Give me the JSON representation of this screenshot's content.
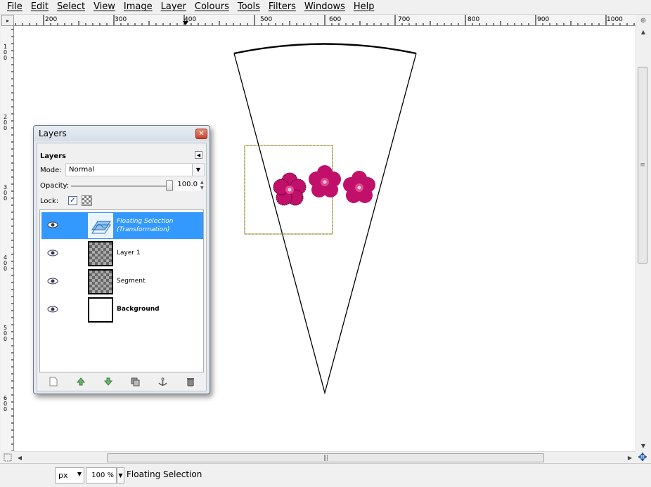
{
  "menubar": {
    "items": [
      "File",
      "Edit",
      "Select",
      "View",
      "Image",
      "Layer",
      "Colours",
      "Tools",
      "Filters",
      "Windows",
      "Help"
    ]
  },
  "ruler": {
    "h_labels": [
      "200",
      "300",
      "400",
      "500",
      "600",
      "700",
      "800",
      "900",
      "1000"
    ],
    "v_labels": [
      "100",
      "200",
      "300",
      "400",
      "500",
      "600"
    ]
  },
  "layers_dialog": {
    "title": "Layers",
    "panel_title": "Layers",
    "mode_label": "Mode:",
    "mode_value": "Normal",
    "opacity_label": "Opacity:",
    "opacity_value": "100.0",
    "lock_label": "Lock:",
    "lock_pixels_checked": true,
    "layers": [
      {
        "name_line1": "Floating Selection",
        "name_line2": "(Transformation)",
        "selected": true,
        "visible": true
      },
      {
        "name_line1": "Layer 1",
        "selected": false,
        "visible": true
      },
      {
        "name_line1": "Segment",
        "selected": false,
        "visible": true
      },
      {
        "name_line1": "Background",
        "selected": false,
        "visible": true
      }
    ],
    "buttons": [
      "new-layer",
      "raise-layer",
      "lower-layer",
      "duplicate-layer",
      "anchor-layer",
      "delete-layer"
    ]
  },
  "statusbar": {
    "unit": "px",
    "zoom": "100 %",
    "message": "Floating Selection"
  },
  "colors": {
    "selection_highlight": "#3399ff",
    "flower": "#c0106a",
    "selection_marquee": "#d8c400"
  }
}
